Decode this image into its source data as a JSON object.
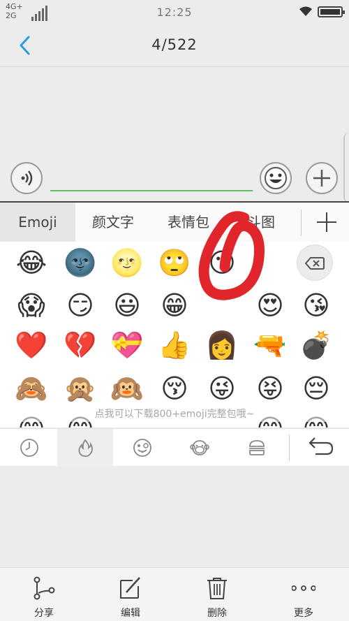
{
  "status_bar": {
    "network_top": "4G+",
    "network_bottom": "2G",
    "time": "12:25",
    "wifi_icon": "wifi-icon",
    "battery_icon": "battery-icon"
  },
  "nav": {
    "back_icon": "chevron-left-icon",
    "counter": "4/522"
  },
  "input_row": {
    "voice_icon": "voice-icon",
    "emoji_icon": "smiley-icon",
    "add_icon": "plus-icon",
    "accent_color": "#5fc05f"
  },
  "keyboard": {
    "tabs": [
      {
        "label": "Emoji",
        "active": true
      },
      {
        "label": "颜文字",
        "active": false
      },
      {
        "label": "表情包",
        "active": false
      },
      {
        "label": "斗图",
        "active": false
      }
    ],
    "add_icon": "plus-icon",
    "emoji_rows": [
      [
        "😂",
        "🌚",
        "🌝",
        "🙄",
        "😶",
        "",
        "😊"
      ],
      [
        "😱",
        "😏",
        "😃",
        "😁",
        "",
        "😍",
        "😘"
      ],
      [
        "❤️",
        "💔",
        "💝",
        "👍",
        "👩",
        "🔫",
        "💣"
      ],
      [
        "🙈",
        "🙊",
        "🙉",
        "😚",
        "😜",
        "😝",
        "😔"
      ],
      [
        "😊",
        "😊",
        "",
        "",
        "",
        "😊",
        "😊"
      ]
    ],
    "delete_icon": "backspace-icon",
    "hint": "点我可以下载800+emoji完整包哦~",
    "categories": [
      {
        "icon": "clock-icon",
        "active": false
      },
      {
        "icon": "flame-icon",
        "active": true
      },
      {
        "icon": "tongue-face-icon",
        "active": false
      },
      {
        "icon": "monkey-icon",
        "active": false
      },
      {
        "icon": "burger-icon",
        "active": false
      }
    ],
    "undo_icon": "undo-icon",
    "annotation_color": "#e0252b"
  },
  "bottom_bar": {
    "items": [
      {
        "icon": "share-icon",
        "label": "分享"
      },
      {
        "icon": "edit-icon",
        "label": "编辑"
      },
      {
        "icon": "trash-icon",
        "label": "删除"
      },
      {
        "icon": "more-icon",
        "label": "更多"
      }
    ]
  }
}
